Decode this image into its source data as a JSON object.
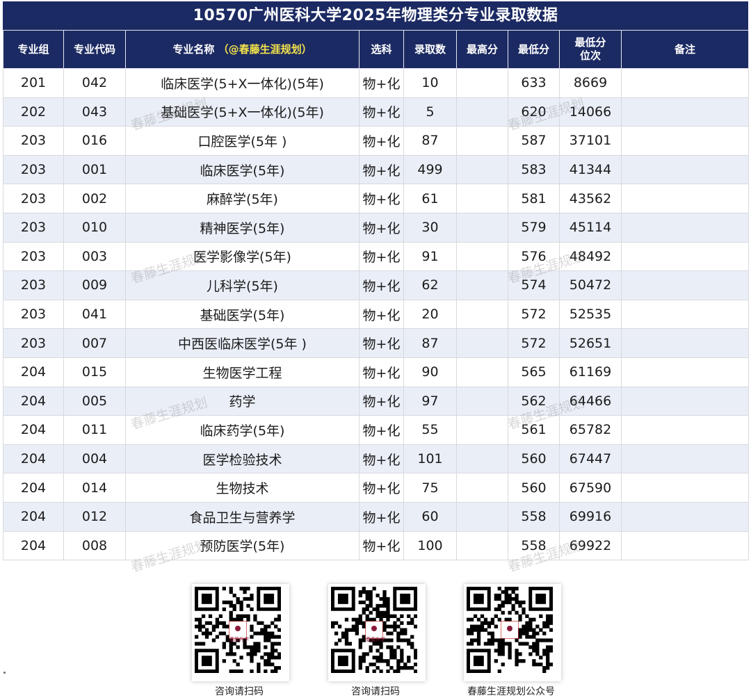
{
  "title": "10570广州医科大学2025年物理类分专业录取数据",
  "columns": {
    "group": "专业组",
    "code": "专业代码",
    "name": "专业名称",
    "name_tag": "（@春藤生涯规划）",
    "subject": "选科",
    "admitted": "录取数",
    "max": "最高分",
    "min": "最低分",
    "rank_l1": "最低分",
    "rank_l2": "位次",
    "note": "备注"
  },
  "rows": [
    {
      "group": "201",
      "code": "042",
      "name": "临床医学(5+X一体化)(5年)",
      "subject": "物+化",
      "admitted": "10",
      "max": "",
      "min": "633",
      "rank": "8669",
      "note": ""
    },
    {
      "group": "202",
      "code": "043",
      "name": "基础医学(5+X一体化)(5年)",
      "subject": "物+化",
      "admitted": "5",
      "max": "",
      "min": "620",
      "rank": "14066",
      "note": ""
    },
    {
      "group": "203",
      "code": "016",
      "name": "口腔医学(5年 )",
      "subject": "物+化",
      "admitted": "87",
      "max": "",
      "min": "587",
      "rank": "37101",
      "note": ""
    },
    {
      "group": "203",
      "code": "001",
      "name": "临床医学(5年)",
      "subject": "物+化",
      "admitted": "499",
      "max": "",
      "min": "583",
      "rank": "41344",
      "note": ""
    },
    {
      "group": "203",
      "code": "002",
      "name": "麻醉学(5年)",
      "subject": "物+化",
      "admitted": "61",
      "max": "",
      "min": "581",
      "rank": "43562",
      "note": ""
    },
    {
      "group": "203",
      "code": "010",
      "name": "精神医学(5年)",
      "subject": "物+化",
      "admitted": "30",
      "max": "",
      "min": "579",
      "rank": "45114",
      "note": ""
    },
    {
      "group": "203",
      "code": "003",
      "name": "医学影像学(5年)",
      "subject": "物+化",
      "admitted": "91",
      "max": "",
      "min": "576",
      "rank": "48492",
      "note": ""
    },
    {
      "group": "203",
      "code": "009",
      "name": "儿科学(5年)",
      "subject": "物+化",
      "admitted": "62",
      "max": "",
      "min": "574",
      "rank": "50472",
      "note": ""
    },
    {
      "group": "203",
      "code": "041",
      "name": "基础医学(5年)",
      "subject": "物+化",
      "admitted": "20",
      "max": "",
      "min": "572",
      "rank": "52535",
      "note": ""
    },
    {
      "group": "203",
      "code": "007",
      "name": "中西医临床医学(5年 )",
      "subject": "物+化",
      "admitted": "87",
      "max": "",
      "min": "572",
      "rank": "52651",
      "note": ""
    },
    {
      "group": "204",
      "code": "015",
      "name": "生物医学工程",
      "subject": "物+化",
      "admitted": "90",
      "max": "",
      "min": "565",
      "rank": "61169",
      "note": ""
    },
    {
      "group": "204",
      "code": "005",
      "name": "药学",
      "subject": "物+化",
      "admitted": "97",
      "max": "",
      "min": "562",
      "rank": "64466",
      "note": ""
    },
    {
      "group": "204",
      "code": "011",
      "name": "临床药学(5年)",
      "subject": "物+化",
      "admitted": "55",
      "max": "",
      "min": "561",
      "rank": "65782",
      "note": ""
    },
    {
      "group": "204",
      "code": "004",
      "name": "医学检验技术",
      "subject": "物+化",
      "admitted": "101",
      "max": "",
      "min": "560",
      "rank": "67447",
      "note": ""
    },
    {
      "group": "204",
      "code": "014",
      "name": "生物技术",
      "subject": "物+化",
      "admitted": "75",
      "max": "",
      "min": "560",
      "rank": "67590",
      "note": ""
    },
    {
      "group": "204",
      "code": "012",
      "name": "食品卫生与营养学",
      "subject": "物+化",
      "admitted": "60",
      "max": "",
      "min": "558",
      "rank": "69916",
      "note": ""
    },
    {
      "group": "204",
      "code": "008",
      "name": "预防医学(5年)",
      "subject": "物+化",
      "admitted": "100",
      "max": "",
      "min": "558",
      "rank": "69922",
      "note": ""
    }
  ],
  "watermark_text": "春藤生涯规划",
  "qr_codes": [
    {
      "caption": "咨询请扫码",
      "icon": "qr-code-icon",
      "logo_text": "春藤升学"
    },
    {
      "caption": "咨询请扫码",
      "icon": "qr-code-icon",
      "logo_text": "春藤升学"
    },
    {
      "caption": "春藤生涯规划公众号",
      "icon": "qr-code-icon",
      "logo_text": ""
    }
  ],
  "colors": {
    "header_bg": "#1c2a63",
    "header_text": "#ffffff",
    "tag_text": "#f2e24a",
    "alt_row": "#eaeef7"
  }
}
